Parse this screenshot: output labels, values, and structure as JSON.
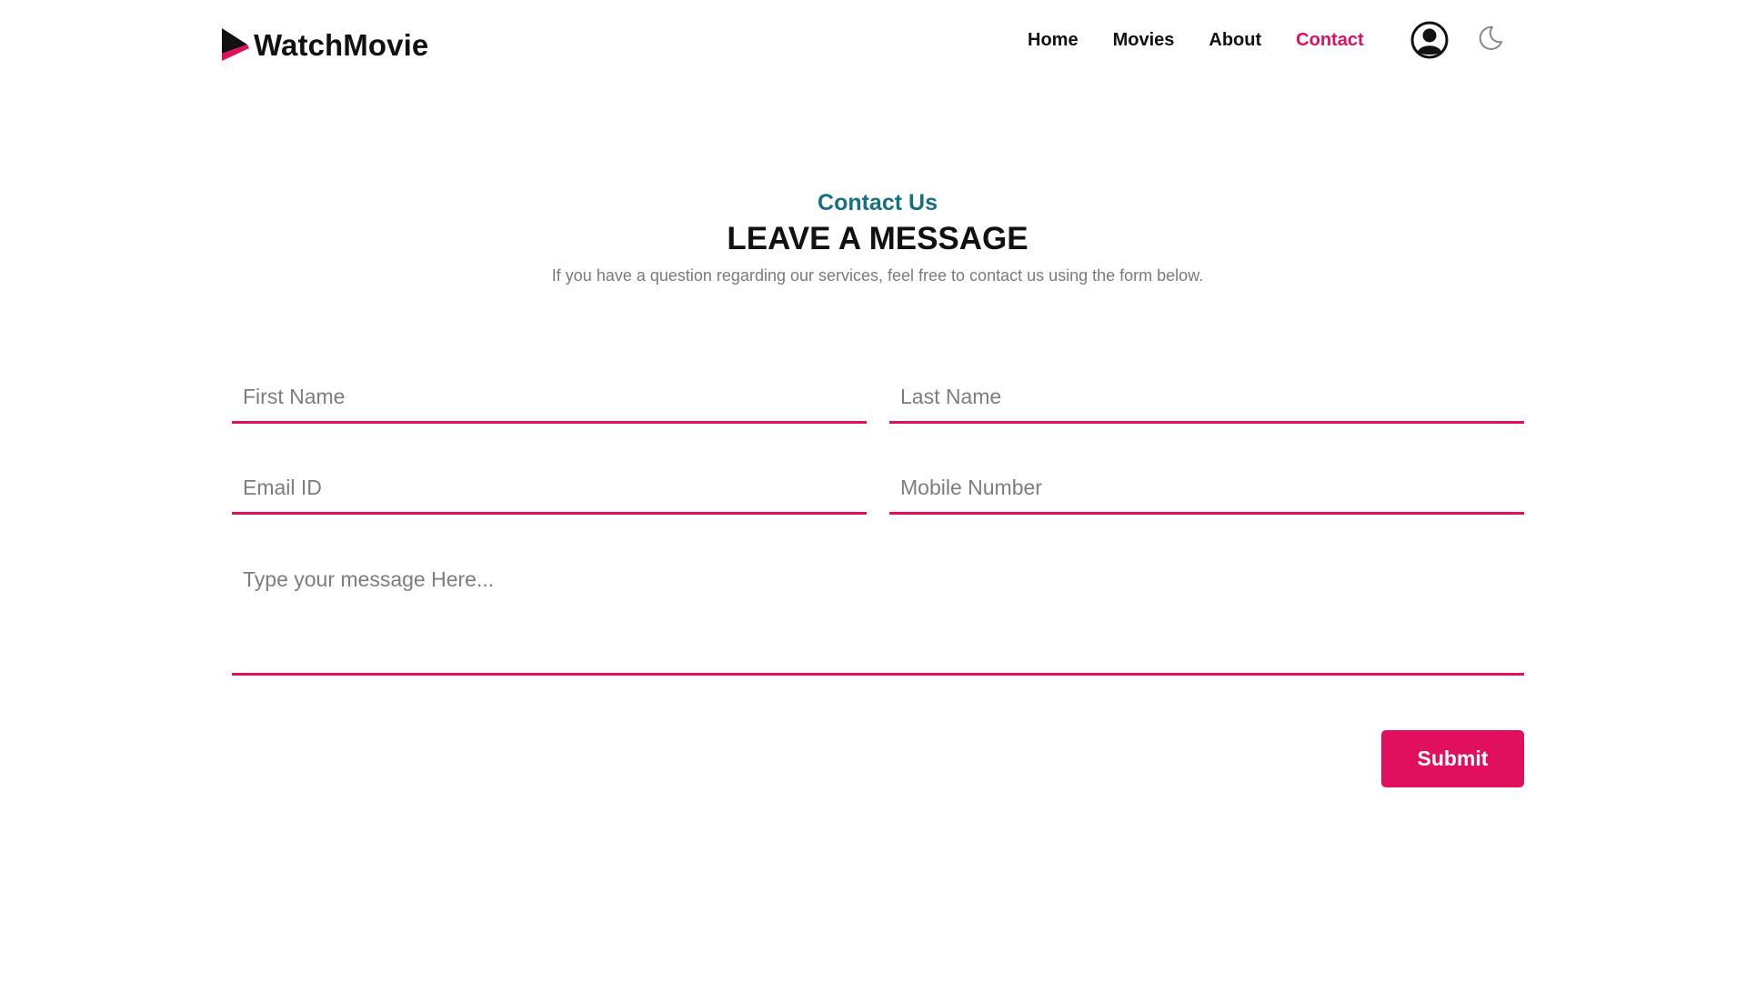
{
  "brand": {
    "name": "WatchMovie",
    "logo_icon": "play-triangle-icon",
    "colors": {
      "accent": "#e0105f",
      "dark": "#111111",
      "teal": "#167080"
    }
  },
  "nav": {
    "links": [
      {
        "label": "Home",
        "active": false
      },
      {
        "label": "Movies",
        "active": false
      },
      {
        "label": "About",
        "active": false
      },
      {
        "label": "Contact",
        "active": true
      }
    ],
    "user_icon": "user-avatar-icon",
    "theme_icon": "moon-icon"
  },
  "header": {
    "eyebrow": "Contact Us",
    "title": "LEAVE A MESSAGE",
    "subtitle": "If you have a question regarding our services, feel free to contact us using the form below."
  },
  "form": {
    "first_name": {
      "placeholder": "First Name",
      "value": ""
    },
    "last_name": {
      "placeholder": "Last Name",
      "value": ""
    },
    "email": {
      "placeholder": "Email ID",
      "value": ""
    },
    "mobile": {
      "placeholder": "Mobile Number",
      "value": ""
    },
    "message": {
      "placeholder": "Type your message Here...",
      "value": ""
    },
    "submit_label": "Submit"
  }
}
